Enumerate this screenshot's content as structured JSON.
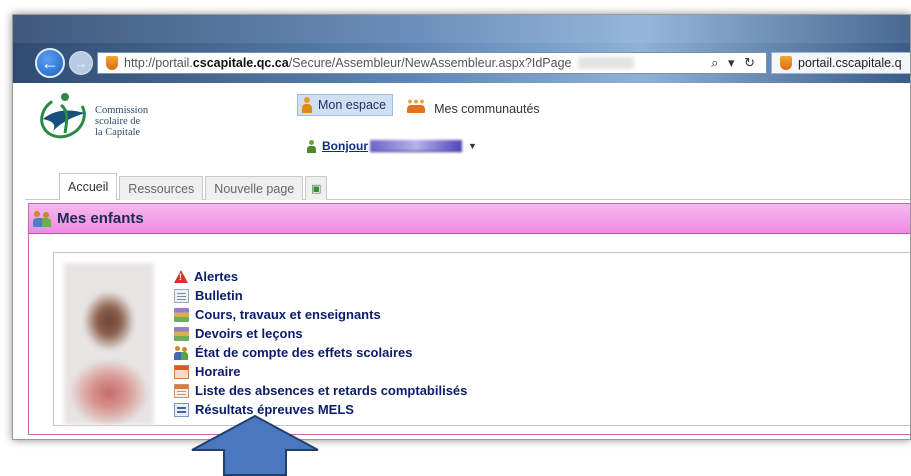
{
  "browser": {
    "url_prefix": "http://portail.",
    "url_host": "cscapitale.qc.ca",
    "url_path": "/Secure/Assembleur/NewAssembleur.aspx?IdPage",
    "search_controls": "⌕ ▾ ↻",
    "tab_title": "portail.cscapitale.q"
  },
  "logo": {
    "line1": "Commission",
    "line2": "scolaire de",
    "line3": "la Capitale"
  },
  "header": {
    "mon_espace": "Mon espace",
    "mes_communautes": "Mes communautés",
    "bonjour": "Bonjour",
    "caret": "▼"
  },
  "tabs": {
    "accueil": "Accueil",
    "ressources": "Ressources",
    "nouvelle_page": "Nouvelle page",
    "add": "▣"
  },
  "portlet": {
    "title": "Mes enfants",
    "items": [
      {
        "label": "Alertes",
        "icon": "warning-icon"
      },
      {
        "label": "Bulletin",
        "icon": "document-icon"
      },
      {
        "label": "Cours, travaux et enseignants",
        "icon": "books-icon"
      },
      {
        "label": "Devoirs et leçons",
        "icon": "books-icon"
      },
      {
        "label": "État de compte des effets scolaires",
        "icon": "people-icon"
      },
      {
        "label": "Horaire",
        "icon": "calendar-icon"
      },
      {
        "label": "Liste des absences et retards comptabilisés",
        "icon": "table-icon"
      },
      {
        "label": "Résultats épreuves MELS",
        "icon": "results-icon"
      }
    ]
  },
  "colors": {
    "portlet_header": "#ee8be2",
    "link": "#0a1c6b",
    "arrow": "#4a78c0"
  }
}
